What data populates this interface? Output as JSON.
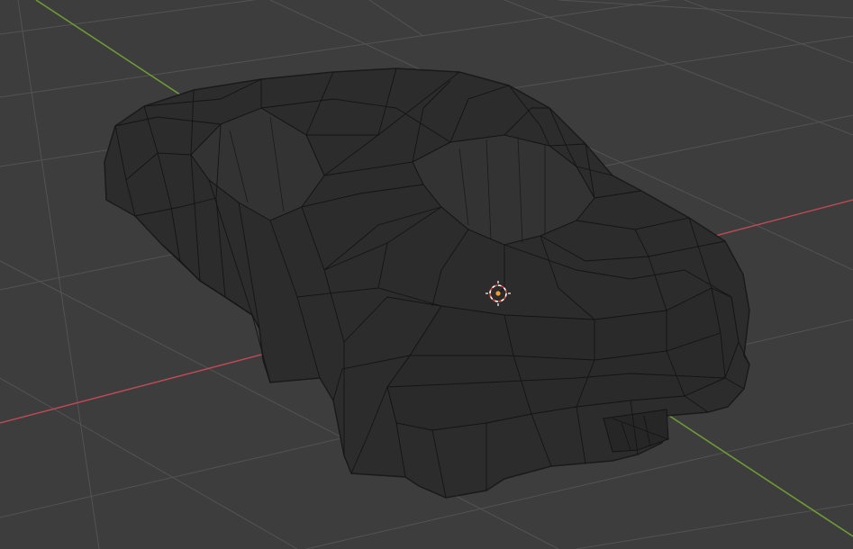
{
  "viewport": {
    "background": "#3d3d3d",
    "grid_color": "#535353",
    "x_axis_color": "#c04a55",
    "y_axis_color": "#6f9a36",
    "mesh_fill": "#2c2c2c",
    "wire_color": "#141414",
    "cursor_colors": [
      "#ffffff",
      "#e0453a"
    ],
    "origin_color": "#f29d2b"
  },
  "object": {
    "icon": "car-wireframe-mesh"
  }
}
